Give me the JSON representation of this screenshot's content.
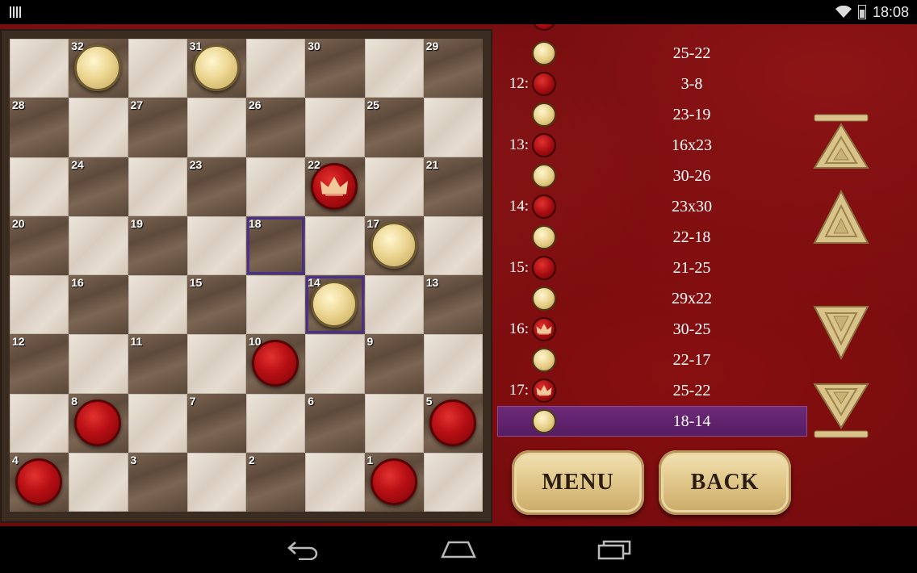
{
  "status_bar": {
    "time": "18:08"
  },
  "board": {
    "squares": [
      {
        "n": 32,
        "piece": "white"
      },
      {
        "n": 31,
        "piece": "white"
      },
      {
        "n": 30,
        "piece": null
      },
      {
        "n": 29,
        "piece": null
      },
      {
        "n": 28,
        "piece": null
      },
      {
        "n": 27,
        "piece": null
      },
      {
        "n": 26,
        "piece": null
      },
      {
        "n": 25,
        "piece": null
      },
      {
        "n": 24,
        "piece": null
      },
      {
        "n": 23,
        "piece": null
      },
      {
        "n": 22,
        "piece": "red-king"
      },
      {
        "n": 21,
        "piece": null
      },
      {
        "n": 20,
        "piece": null
      },
      {
        "n": 19,
        "piece": null
      },
      {
        "n": 18,
        "piece": null
      },
      {
        "n": 17,
        "piece": "white"
      },
      {
        "n": 16,
        "piece": null
      },
      {
        "n": 15,
        "piece": null
      },
      {
        "n": 14,
        "piece": "white"
      },
      {
        "n": 13,
        "piece": null
      },
      {
        "n": 12,
        "piece": null
      },
      {
        "n": 11,
        "piece": null
      },
      {
        "n": 10,
        "piece": "red"
      },
      {
        "n": 9,
        "piece": null
      },
      {
        "n": 8,
        "piece": "red"
      },
      {
        "n": 7,
        "piece": null
      },
      {
        "n": 6,
        "piece": null
      },
      {
        "n": 5,
        "piece": "red"
      },
      {
        "n": 4,
        "piece": "red"
      },
      {
        "n": 3,
        "piece": null
      },
      {
        "n": 2,
        "piece": null
      },
      {
        "n": 1,
        "piece": "red"
      }
    ],
    "highlighted": [
      18,
      14
    ]
  },
  "moves": [
    {
      "num": "",
      "side": "white",
      "text": "25-22"
    },
    {
      "num": "12:",
      "side": "red",
      "text": "3-8"
    },
    {
      "num": "",
      "side": "white",
      "text": "23-19"
    },
    {
      "num": "13:",
      "side": "red",
      "text": "16x23"
    },
    {
      "num": "",
      "side": "white",
      "text": "30-26"
    },
    {
      "num": "14:",
      "side": "red",
      "text": "23x30"
    },
    {
      "num": "",
      "side": "white",
      "text": "22-18"
    },
    {
      "num": "15:",
      "side": "red",
      "text": "21-25"
    },
    {
      "num": "",
      "side": "white",
      "text": "29x22"
    },
    {
      "num": "16:",
      "side": "red-king",
      "text": "30-25"
    },
    {
      "num": "",
      "side": "white",
      "text": "22-17"
    },
    {
      "num": "17:",
      "side": "red-king",
      "text": "25-22"
    },
    {
      "num": "",
      "side": "white",
      "text": "18-14",
      "selected": true
    }
  ],
  "buttons": {
    "menu": "MENU",
    "back": "BACK"
  },
  "icons": {
    "nav_first": "first-move-icon",
    "nav_prev": "previous-move-icon",
    "nav_next": "next-move-icon",
    "nav_last": "last-move-icon",
    "android_back": "back-icon",
    "android_home": "home-icon",
    "android_recents": "recents-icon"
  },
  "colors": {
    "highlight": "#4b2f8c",
    "selected_row": "#6d2a78",
    "background": "#6e0a0c"
  }
}
